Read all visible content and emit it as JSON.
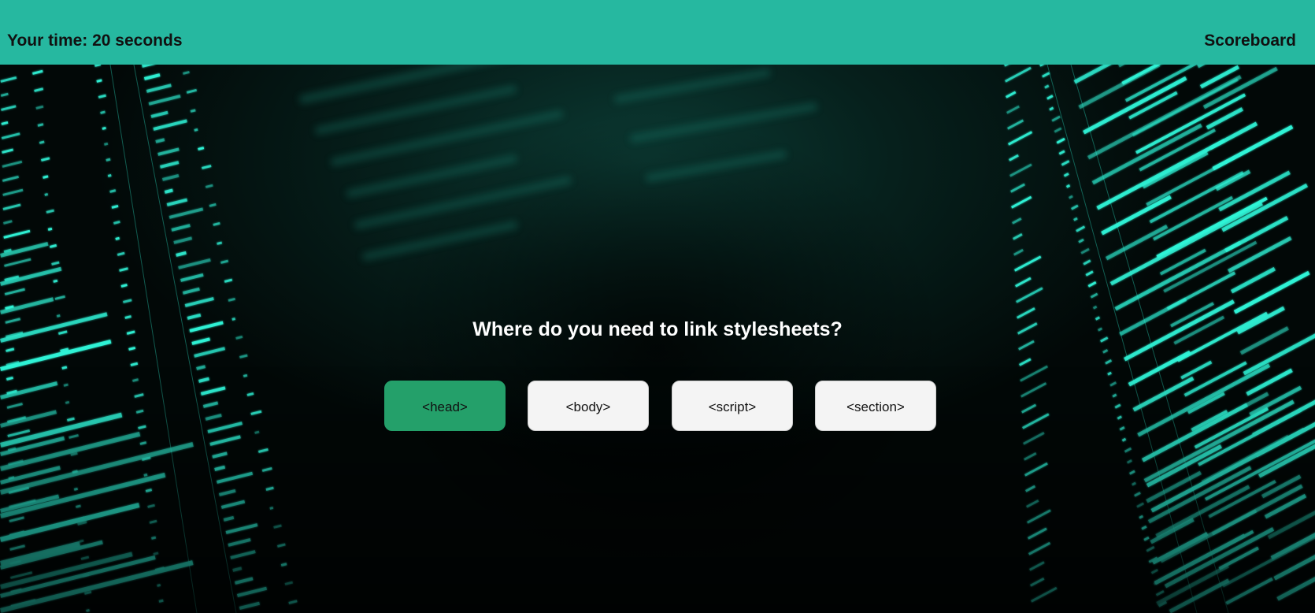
{
  "header": {
    "timer_text": "Your time: 20 seconds",
    "scoreboard_label": "Scoreboard"
  },
  "quiz": {
    "question": "Where do you need to link stylesheets?",
    "answers": [
      {
        "label": "<head>",
        "state": "correct"
      },
      {
        "label": "<body>",
        "state": "default"
      },
      {
        "label": "<script>",
        "state": "default"
      },
      {
        "label": "<section>",
        "state": "default"
      }
    ]
  },
  "colors": {
    "header_bg": "#26b8a0",
    "correct_answer_bg": "#24a06a",
    "answer_bg": "#f4f4f4",
    "code_glow": "#2ff5d8"
  }
}
